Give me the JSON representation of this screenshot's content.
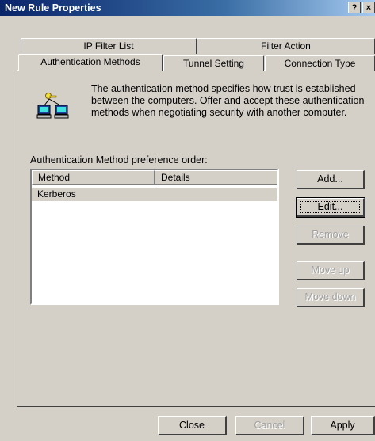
{
  "window": {
    "title": "New Rule Properties",
    "help_label": "?",
    "close_label": "×"
  },
  "tabs": {
    "back": [
      "IP Filter List",
      "Filter Action"
    ],
    "front": [
      "Authentication Methods",
      "Tunnel Setting",
      "Connection Type"
    ]
  },
  "description": "The authentication method specifies how trust is established between the computers. Offer and accept these authentication methods when negotiating security with another computer.",
  "list": {
    "label": "Authentication Method preference order:",
    "columns": [
      "Method",
      "Details"
    ],
    "rows": [
      {
        "method": "Kerberos",
        "details": ""
      }
    ]
  },
  "side_buttons": {
    "add": "Add...",
    "edit": "Edit...",
    "remove": "Remove",
    "move_up": "Move up",
    "move_down": "Move down"
  },
  "bottom_buttons": {
    "close": "Close",
    "cancel": "Cancel",
    "apply": "Apply"
  }
}
